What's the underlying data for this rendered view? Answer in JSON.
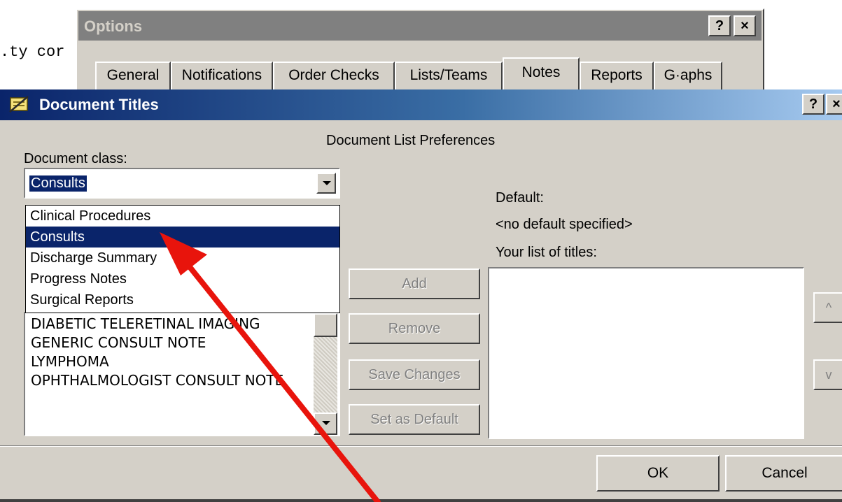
{
  "background_text": ".ty cor",
  "options_window": {
    "title": "Options",
    "help_button": "?",
    "close_button": "×",
    "tabs": [
      {
        "label": "General",
        "active": false
      },
      {
        "label": "Notifications",
        "active": false
      },
      {
        "label": "Order Checks",
        "active": false
      },
      {
        "label": "Lists/Teams",
        "active": false
      },
      {
        "label": "Notes",
        "active": true
      },
      {
        "label": "Reports",
        "active": false
      },
      {
        "label": "G·aphs",
        "active": false
      }
    ]
  },
  "dialog": {
    "title": "Document Titles",
    "help_button": "?",
    "close_button": "×",
    "heading": "Document List Preferences",
    "document_class_label": "Document class:",
    "document_class_value": "Consults",
    "document_class_options": [
      {
        "label": "Clinical Procedures",
        "selected": false
      },
      {
        "label": "Consults",
        "selected": true
      },
      {
        "label": "Discharge Summary",
        "selected": false
      },
      {
        "label": "Progress Notes",
        "selected": false
      },
      {
        "label": "Surgical Reports",
        "selected": false
      }
    ],
    "titles_list": [
      "DIABETIC TELERETINAL IMAGING",
      "GENERIC CONSULT NOTE",
      "LYMPHOMA",
      "OPHTHALMOLOGIST CONSULT NOTE"
    ],
    "default_label": "Default:",
    "default_value": "<no default specified>",
    "your_list_label": "Your list of titles:",
    "your_list_items": [],
    "buttons": {
      "add": "Add",
      "remove": "Remove",
      "save_changes": "Save Changes",
      "set_as_default": "Set as Default",
      "move_up": "^",
      "move_down": "v",
      "ok": "OK",
      "cancel": "Cancel"
    }
  },
  "colors": {
    "window_face": "#d4d0c8",
    "selection": "#0a246a",
    "annotation_arrow": "#e8140c"
  }
}
